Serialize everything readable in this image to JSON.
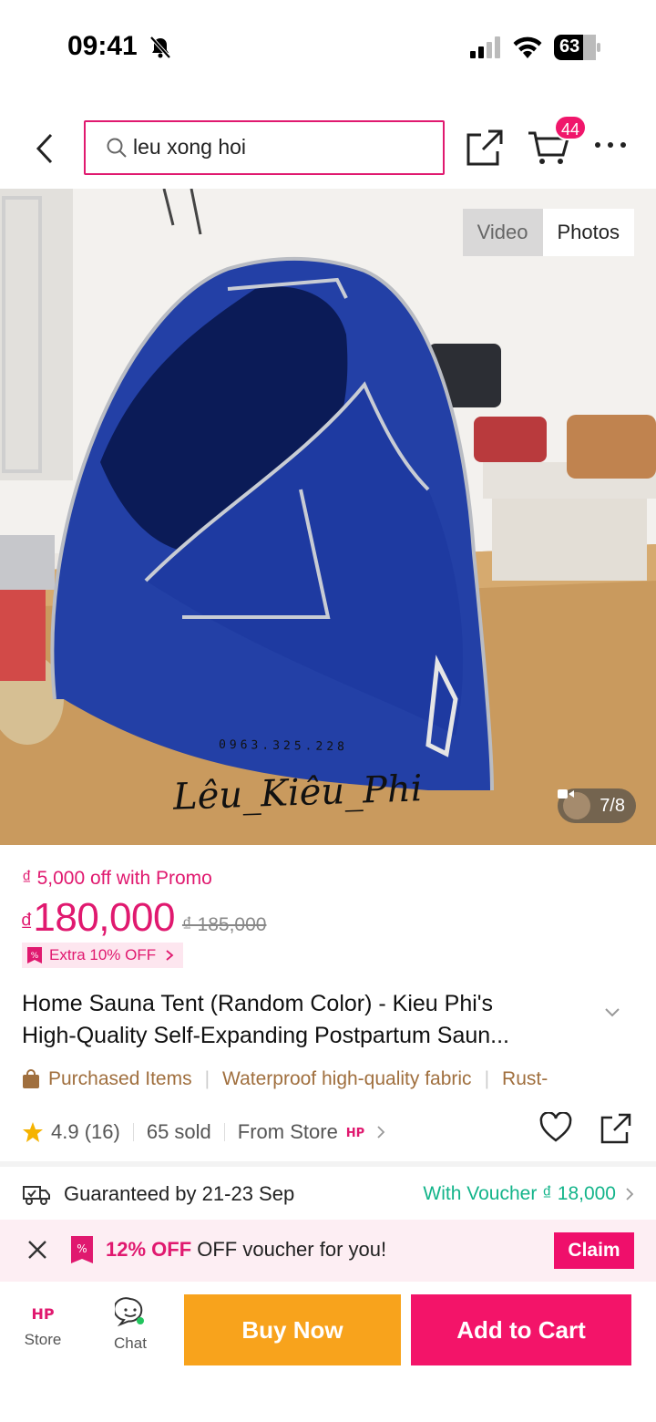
{
  "status_bar": {
    "time": "09:41",
    "battery": "63"
  },
  "search": {
    "query": "leu xong hoi"
  },
  "cart": {
    "badge_count": "44"
  },
  "media": {
    "tab_video": "Video",
    "tab_photos": "Photos",
    "counter": "7/8",
    "watermark_phone": "0963.325.228",
    "watermark_name": "Lêu_Kiêu_Phi"
  },
  "pricing": {
    "promo_text": "₫ 5,000 off with Promo",
    "currency": "₫",
    "price": "180,000",
    "old_price": "₫ 185,000",
    "extra_badge": "Extra 10% OFF"
  },
  "product": {
    "title_line_1": "Home Sauna Tent (Random Color) - Kieu Phi's",
    "title_line_2": "High-Quality Self-Expanding Postpartum Saun..."
  },
  "features": [
    "Purchased Items",
    "Waterproof high-quality fabric",
    "Rust-"
  ],
  "stats": {
    "rating": "4.9 (16)",
    "sold": "65 sold",
    "from_store": "From Store"
  },
  "delivery": {
    "guarantee": "Guaranteed by 21-23 Sep",
    "voucher": "With Voucher ₫ 18,000"
  },
  "voucher_banner": {
    "highlight": "12% OFF",
    "text": " OFF voucher for you!",
    "claim_label": "Claim"
  },
  "bottom_nav": {
    "store_label": "Store",
    "chat_label": "Chat",
    "buy_now_label": "Buy Now",
    "add_to_cart_label": "Add to Cart"
  },
  "colors": {
    "brand_pink": "#e0196f",
    "buy_now_orange": "#f8a31c",
    "voucher_green": "#13b48a"
  }
}
